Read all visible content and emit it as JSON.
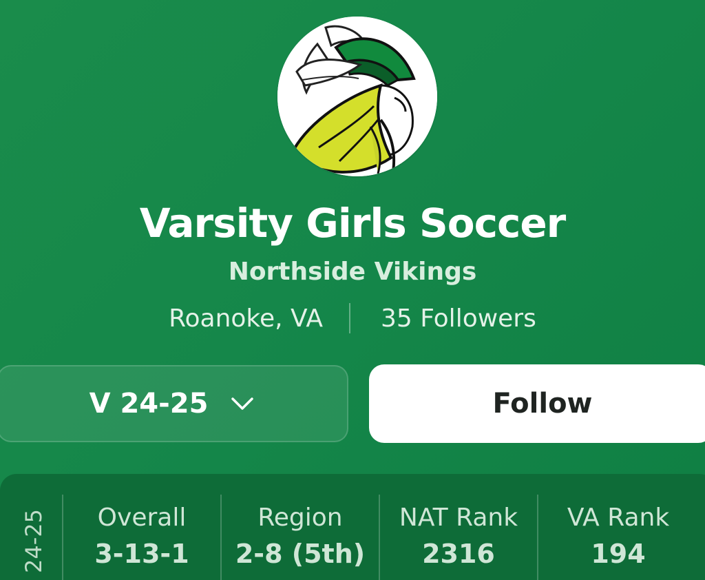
{
  "team": {
    "name": "Varsity Girls Soccer",
    "school": "Northside Vikings",
    "location": "Roanoke, VA",
    "followers": "35 Followers",
    "logo_icon": "viking-mascot-icon"
  },
  "controls": {
    "season_label": "V 24-25",
    "season_chevron_icon": "chevron-down-icon",
    "follow_label": "Follow"
  },
  "stats": {
    "season": "24-25",
    "items": [
      {
        "label": "Overall",
        "value": "3-13-1"
      },
      {
        "label": "Region",
        "value": "2-8 (5th)"
      },
      {
        "label": "NAT Rank",
        "value": "2316"
      },
      {
        "label": "VA Rank",
        "value": "194"
      }
    ]
  },
  "colors": {
    "background": "#16894a",
    "card": "#0e6c38",
    "button_bg": "#ffffff",
    "button_text": "#1f2421"
  }
}
